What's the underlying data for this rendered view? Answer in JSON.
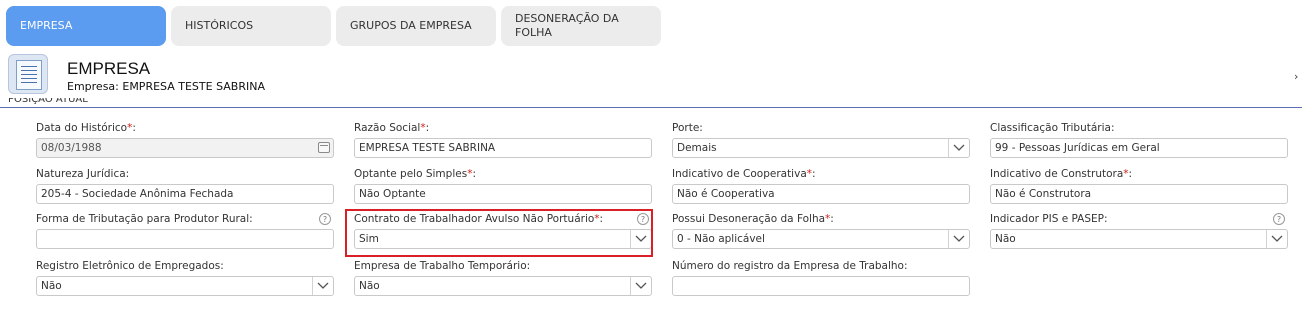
{
  "tabs": [
    {
      "label": "EMPRESA",
      "active": true
    },
    {
      "label": "HISTÓRICOS",
      "active": false
    },
    {
      "label": "GRUPOS DA EMPRESA",
      "active": false
    },
    {
      "label": "DESONERAÇÃO DA FOLHA",
      "active": false
    }
  ],
  "header": {
    "title": "EMPRESA",
    "subtitle": "Empresa: EMPRESA TESTE SABRINA",
    "icon": "document-icon",
    "collapse_icon": "chevron-right-icon"
  },
  "section": {
    "title": "POSIÇÃO ATUAL"
  },
  "colors": {
    "accent_tab": "#5b9bf0",
    "required_star": "#d0201b",
    "highlight_border": "#d92027",
    "divider": "#5a6fb0"
  },
  "fields": {
    "data_historico": {
      "label": "Data do Histórico",
      "required": "*",
      "colon": ":",
      "value": "08/03/1988"
    },
    "razao_social": {
      "label": "Razão Social",
      "required": "*",
      "colon": ":",
      "value": "EMPRESA TESTE SABRINA"
    },
    "porte": {
      "label": "Porte:",
      "value": "Demais"
    },
    "classificacao_tributaria": {
      "label": "Classificação Tributária:",
      "value": "99 - Pessoas Jurídicas em Geral"
    },
    "natureza_juridica": {
      "label": "Natureza Jurídica:",
      "value": "205-4 - Sociedade Anônima Fechada"
    },
    "optante_simples": {
      "label": "Optante pelo Simples",
      "required": "*",
      "colon": ":",
      "value": "Não Optante"
    },
    "indicativo_cooperativa": {
      "label": "Indicativo de Cooperativa",
      "required": "*",
      "colon": ":",
      "value": "Não é Cooperativa"
    },
    "indicativo_construtora": {
      "label": "Indicativo de Construtora",
      "required": "*",
      "colon": ":",
      "value": "Não é Construtora"
    },
    "forma_tributacao": {
      "label": "Forma de Tributação para Produtor Rural:",
      "value": ""
    },
    "contrato_avulso": {
      "label": "Contrato de Trabalhador Avulso Não Portuário",
      "required": "*",
      "colon": ":",
      "value": "Sim"
    },
    "possui_desoneracao": {
      "label": "Possui Desoneração da Folha",
      "required": "*",
      "colon": ":",
      "value": "0 - Não aplicável"
    },
    "indicador_pis": {
      "label": "Indicador PIS e PASEP:",
      "value": "Não"
    },
    "registro_eletronico": {
      "label": "Registro Eletrônico de Empregados:",
      "value": "Não"
    },
    "empresa_temporario": {
      "label": "Empresa de Trabalho Temporário:",
      "value": "Não"
    },
    "numero_registro": {
      "label": "Número do registro da Empresa de Trabalho:",
      "value": ""
    }
  },
  "help_icon_text": "?"
}
